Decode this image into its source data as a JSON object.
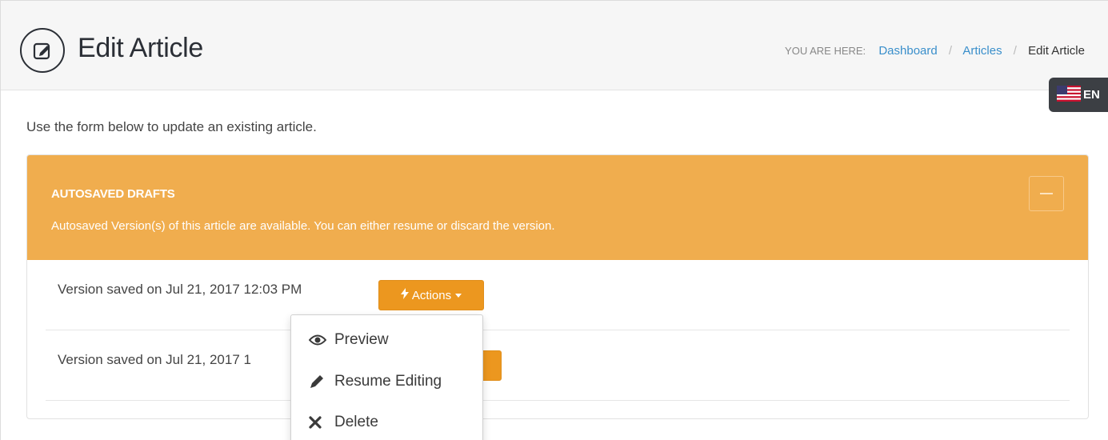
{
  "header": {
    "title": "Edit Article",
    "breadcrumb": {
      "prefix": "YOU ARE HERE:",
      "items": [
        "Dashboard",
        "Articles"
      ],
      "current": "Edit Article"
    }
  },
  "language": {
    "code": "EN",
    "flag_icon": "us-flag-icon"
  },
  "intro": "Use the form below to update an existing article.",
  "autosave_panel": {
    "title": "AUTOSAVED DRAFTS",
    "subtitle": "Autosaved Version(s) of this article are available. You can either resume or discard the version.",
    "collapse_icon": "minus-icon",
    "color": "#f0ad4e",
    "versions": [
      {
        "label": "Version saved on Jul 21, 2017 12:03 PM",
        "action_label": "Actions"
      },
      {
        "label": "Version saved on Jul 21, 2017 1"
      }
    ]
  },
  "dropdown": {
    "items": [
      {
        "label": "Preview",
        "icon": "eye-icon"
      },
      {
        "label": "Resume Editing",
        "icon": "pencil-icon"
      },
      {
        "label": "Delete",
        "icon": "times-icon"
      }
    ]
  },
  "colors": {
    "accent": "#f0ad4e",
    "button": "#ec971f",
    "link": "#3a8fcb"
  }
}
